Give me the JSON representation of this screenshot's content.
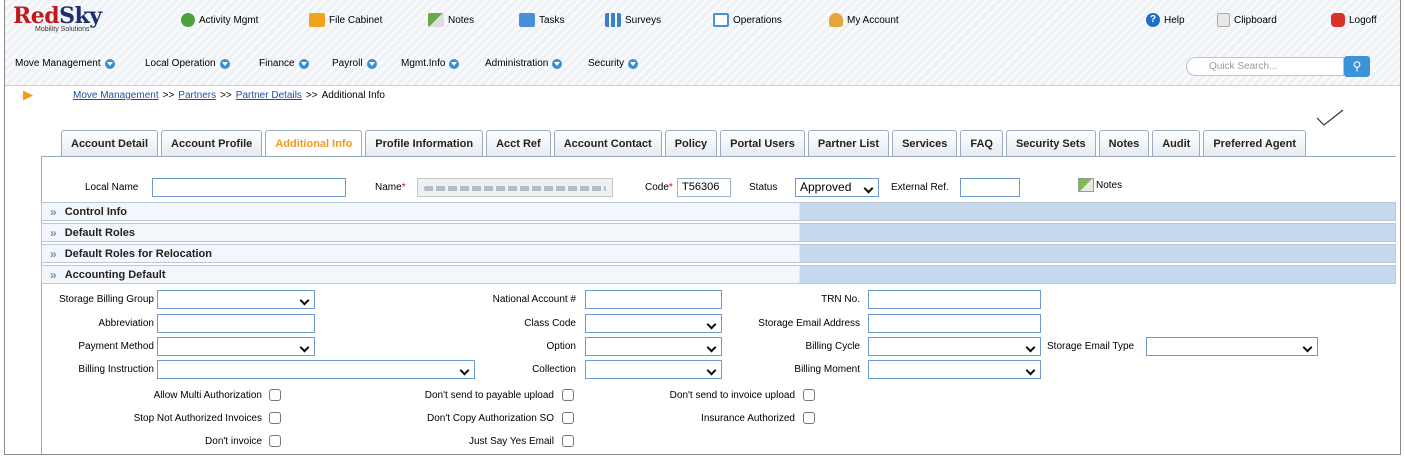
{
  "brand": {
    "name_red": "Red",
    "name_blue": "Sky",
    "tagline": "Mobility Solutions"
  },
  "app_nav": [
    {
      "label": "Activity Mgmt",
      "icon": "gears-icon",
      "color": "#4aa33a"
    },
    {
      "label": "File Cabinet",
      "icon": "folder-icon",
      "color": "#f3a21e"
    },
    {
      "label": "Notes",
      "icon": "pencil-icon",
      "color": "#6aa84f"
    },
    {
      "label": "Tasks",
      "icon": "calendar-icon",
      "color": "#4a90d9"
    },
    {
      "label": "Surveys",
      "icon": "bar-chart-icon",
      "color": "#3a7fd0"
    },
    {
      "label": "Operations",
      "icon": "window-icon",
      "color": "#4a90d9"
    },
    {
      "label": "My Account",
      "icon": "user-icon",
      "color": "#e2a63a"
    },
    {
      "label": "Help",
      "icon": "help-icon",
      "color": "#1f6fc5"
    },
    {
      "label": "Clipboard",
      "icon": "clipboard-icon",
      "color": "#d9d9d9"
    },
    {
      "label": "Logoff",
      "icon": "power-icon",
      "color": "#d9322b"
    }
  ],
  "menu": [
    "Move Management",
    "Local Operation",
    "Finance",
    "Payroll",
    "Mgmt.Info",
    "Administration",
    "Security"
  ],
  "search": {
    "placeholder": "Quick Search..."
  },
  "breadcrumb": {
    "links": [
      "Move Management",
      "Partners",
      "Partner Details"
    ],
    "sep": ">>",
    "current": "Additional Info"
  },
  "tabs": [
    "Account Detail",
    "Account Profile",
    "Additional Info",
    "Profile Information",
    "Acct Ref",
    "Account Contact",
    "Policy",
    "Portal Users",
    "Partner List",
    "Services",
    "FAQ",
    "Security Sets",
    "Notes",
    "Audit",
    "Preferred Agent"
  ],
  "active_tab": "Additional Info",
  "header_fields": {
    "local_name_label": "Local Name",
    "name_label": "Name",
    "code_label": "Code",
    "code_value": "T56306",
    "status_label": "Status",
    "status_value": "Approved",
    "external_ref_label": "External Ref.",
    "notes_label": "Notes"
  },
  "sections": [
    "Control Info",
    "Default Roles",
    "Default Roles for Relocation",
    "Accounting Default"
  ],
  "accounting": {
    "storage_billing_group": "Storage Billing Group",
    "abbreviation": "Abbreviation",
    "payment_method": "Payment Method",
    "billing_instruction": "Billing Instruction",
    "national_account": "National Account #",
    "class_code": "Class Code",
    "option": "Option",
    "collection": "Collection",
    "trn_no": "TRN No.",
    "storage_email_address": "Storage Email Address",
    "billing_cycle": "Billing Cycle",
    "billing_moment": "Billing Moment",
    "storage_email_type": "Storage Email Type"
  },
  "checkboxes": {
    "allow_multi": "Allow Multi Authorization",
    "stop_not_auth": "Stop Not Authorized Invoices",
    "dont_invoice": "Don't invoice",
    "dont_send_payable": "Don't send to payable upload",
    "dont_copy_auth": "Don't Copy Authorization SO",
    "just_say_yes": "Just Say Yes Email",
    "dont_send_invoice": "Don't send to invoice upload",
    "insurance_auth": "Insurance Authorized"
  }
}
